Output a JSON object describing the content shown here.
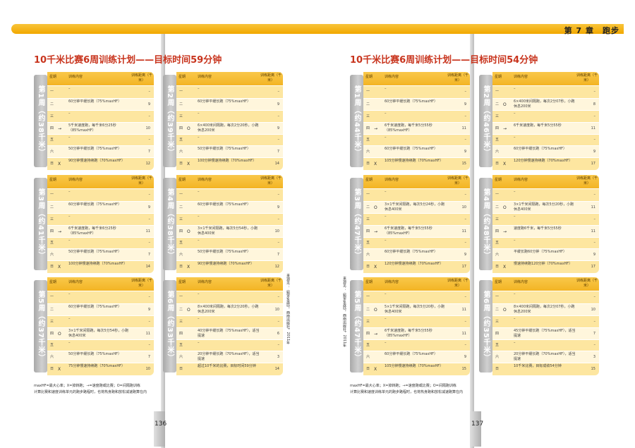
{
  "chapter": "第 7 章　跑步",
  "pages": [
    {
      "title": "10千米比赛6周训练计划——目标时间59分钟",
      "page_number": "136",
      "footnote_lines": [
        "maxHF=最大心率；X=掉转跑；→=速度跑或比赛；O=间隔跑训练",
        "计算比赛和速度训练单元的跑步路程时，也将热身跑和放松减速跑算在内"
      ],
      "source": "来源见：《跑步圣经》，西南出版社，2011年",
      "weeks": [
        {
          "label": "第1周（约38千米）",
          "rows": [
            {
              "day": "一",
              "mark": "",
              "content": "–",
              "dist": "–"
            },
            {
              "day": "二",
              "mark": "",
              "content": "60分钟平缓长跑（75%maxHF）",
              "dist": "9"
            },
            {
              "day": "三",
              "mark": "",
              "content": "–",
              "dist": "–"
            },
            {
              "day": "四",
              "mark": "→",
              "content": "5千米速度跑，每千米6分25秒（85%maxHF）",
              "dist": "10"
            },
            {
              "day": "五",
              "mark": "",
              "content": "–",
              "dist": "–"
            },
            {
              "day": "六",
              "mark": "",
              "content": "50分钟平缓长跑（75%maxHF）",
              "dist": "7"
            },
            {
              "day": "日",
              "mark": "X",
              "content": "90分钟慢速持续跑（70%maxHF）",
              "dist": "12"
            }
          ]
        },
        {
          "label": "第2周（约39千米）",
          "rows": [
            {
              "day": "一",
              "mark": "",
              "content": "–",
              "dist": "–"
            },
            {
              "day": "二",
              "mark": "",
              "content": "60分钟平缓长跑（75%maxHF）",
              "dist": "9"
            },
            {
              "day": "三",
              "mark": "",
              "content": "–",
              "dist": "–"
            },
            {
              "day": "四",
              "mark": "O",
              "content": "6×400米间隔跑，每次2分20秒，小跑休息200米",
              "dist": "9"
            },
            {
              "day": "五",
              "mark": "",
              "content": "–",
              "dist": "–"
            },
            {
              "day": "六",
              "mark": "",
              "content": "50分钟平缓长跑（75%maxHF）",
              "dist": "7"
            },
            {
              "day": "日",
              "mark": "X",
              "content": "100分钟慢速持续跑（70%maxHF）",
              "dist": "14"
            }
          ]
        },
        {
          "label": "第3周（约41千米）",
          "rows": [
            {
              "day": "一",
              "mark": "",
              "content": "–",
              "dist": "–"
            },
            {
              "day": "二",
              "mark": "",
              "content": "60分钟平缓长跑（75%maxHF）",
              "dist": "9"
            },
            {
              "day": "三",
              "mark": "",
              "content": "–",
              "dist": "–"
            },
            {
              "day": "四",
              "mark": "→",
              "content": "6千米速度跑，每千米6分25秒（85%maxHF）",
              "dist": "11"
            },
            {
              "day": "五",
              "mark": "",
              "content": "–",
              "dist": "–"
            },
            {
              "day": "六",
              "mark": "",
              "content": "50分钟平缓长跑（75%maxHF）",
              "dist": "7"
            },
            {
              "day": "日",
              "mark": "X",
              "content": "100分钟慢速持续跑（70%maxHF）",
              "dist": "14"
            }
          ]
        },
        {
          "label": "第4周（约38千米）",
          "rows": [
            {
              "day": "一",
              "mark": "",
              "content": "–",
              "dist": "–"
            },
            {
              "day": "二",
              "mark": "",
              "content": "60分钟平缓长跑（75%maxHF）",
              "dist": "9"
            },
            {
              "day": "三",
              "mark": "",
              "content": "–",
              "dist": "–"
            },
            {
              "day": "四",
              "mark": "O",
              "content": "3×1千米间隔跑，每次5分54秒，小跑休息400米",
              "dist": "10"
            },
            {
              "day": "五",
              "mark": "",
              "content": "–",
              "dist": "–"
            },
            {
              "day": "六",
              "mark": "",
              "content": "50分钟平缓长跑（75%maxHF）",
              "dist": "7"
            },
            {
              "day": "日",
              "mark": "X",
              "content": "90分钟慢速持续跑（70%maxHF）",
              "dist": "12"
            }
          ]
        },
        {
          "label": "第5周（约37千米）",
          "rows": [
            {
              "day": "一",
              "mark": "",
              "content": "–",
              "dist": "–"
            },
            {
              "day": "二",
              "mark": "",
              "content": "60分钟平缓长跑（75%maxHF）",
              "dist": "9"
            },
            {
              "day": "三",
              "mark": "",
              "content": "–",
              "dist": "–"
            },
            {
              "day": "四",
              "mark": "O",
              "content": "3×1千米间隔跑，每次5分54秒，小跑休息400米",
              "dist": "11"
            },
            {
              "day": "五",
              "mark": "",
              "content": "–",
              "dist": "–"
            },
            {
              "day": "六",
              "mark": "",
              "content": "50分钟平缓长跑（75%maxHF）",
              "dist": "7"
            },
            {
              "day": "日",
              "mark": "X",
              "content": "75分钟慢速持续跑（70%maxHF）",
              "dist": "10"
            }
          ]
        },
        {
          "label": "第6周（约33千米）",
          "rows": [
            {
              "day": "一",
              "mark": "",
              "content": "–",
              "dist": "–"
            },
            {
              "day": "二",
              "mark": "O",
              "content": "8×400米间隔跑，每次2分20秒，小跑休息200米",
              "dist": "10"
            },
            {
              "day": "三",
              "mark": "",
              "content": "–",
              "dist": "–"
            },
            {
              "day": "四",
              "mark": "",
              "content": "40分钟平缓长跑（75%maxHF），适当提速",
              "dist": "6"
            },
            {
              "day": "五",
              "mark": "",
              "content": "–",
              "dist": "–"
            },
            {
              "day": "六",
              "mark": "",
              "content": "20分钟平缓长跑（70%maxHF），适当提速",
              "dist": "3"
            },
            {
              "day": "日",
              "mark": "",
              "content": "超过10千米的比赛，目标时间59分钟",
              "dist": "14"
            }
          ]
        }
      ]
    },
    {
      "title": "10千米比赛6周训练计划——目标时间54分钟",
      "page_number": "137",
      "footnote_lines": [
        "maxHF=最大心率；X=掉转跑；→=速度跑或比赛；O=间隔跑训练",
        "计算比赛和速度训练单元的跑步路程时，也将热身跑和放松减速跑算在内"
      ],
      "source": "来源见：《跑步圣经》，西南出版社，2011年",
      "weeks": [
        {
          "label": "第1周（约44千米）",
          "rows": [
            {
              "day": "一",
              "mark": "",
              "content": "–",
              "dist": "–"
            },
            {
              "day": "二",
              "mark": "",
              "content": "60分钟平缓长跑（75%maxHF）",
              "dist": "9"
            },
            {
              "day": "三",
              "mark": "",
              "content": "–",
              "dist": "–"
            },
            {
              "day": "四",
              "mark": "→",
              "content": "6千米速度跑，每千米5分55秒（85%maxHF）",
              "dist": "11"
            },
            {
              "day": "五",
              "mark": "",
              "content": "–",
              "dist": "–"
            },
            {
              "day": "六",
              "mark": "",
              "content": "60分钟平缓长跑（75%maxHF）",
              "dist": "9"
            },
            {
              "day": "日",
              "mark": "X",
              "content": "105分钟慢速持续跑（70%maxHF）",
              "dist": "15"
            }
          ]
        },
        {
          "label": "第2周（约46千米）",
          "rows": [
            {
              "day": "一",
              "mark": "",
              "content": "–",
              "dist": "–"
            },
            {
              "day": "二",
              "mark": "O",
              "content": "6×400米间隔跑，每次2分07秒，小跑休息200米",
              "dist": "8"
            },
            {
              "day": "三",
              "mark": "",
              "content": "–",
              "dist": "–"
            },
            {
              "day": "四",
              "mark": "→",
              "content": "6千米速度跑，每千米5分55秒",
              "dist": "11"
            },
            {
              "day": "五",
              "mark": "",
              "content": "–",
              "dist": "–"
            },
            {
              "day": "六",
              "mark": "",
              "content": "60分钟平缓长跑（75%maxHF）",
              "dist": "9"
            },
            {
              "day": "日",
              "mark": "X",
              "content": "120分钟慢速持续跑（70%maxHF）",
              "dist": "17"
            }
          ]
        },
        {
          "label": "第3周（约47千米）",
          "rows": [
            {
              "day": "一",
              "mark": "",
              "content": "–",
              "dist": "–"
            },
            {
              "day": "二",
              "mark": "O",
              "content": "3×1千米间隔跑，每次5分24秒，小跑休息400米",
              "dist": "10"
            },
            {
              "day": "三",
              "mark": "",
              "content": "–",
              "dist": "–"
            },
            {
              "day": "四",
              "mark": "→",
              "content": "6千米速度跑，每千米5分55秒（85%maxHF）",
              "dist": "11"
            },
            {
              "day": "五",
              "mark": "",
              "content": "–",
              "dist": "–"
            },
            {
              "day": "六",
              "mark": "",
              "content": "60分钟平缓长跑（75%maxHF）",
              "dist": "9"
            },
            {
              "day": "日",
              "mark": "X",
              "content": "120分钟慢速持续跑（70%maxHF）",
              "dist": "17"
            }
          ]
        },
        {
          "label": "第4周（约48千米）",
          "rows": [
            {
              "day": "一",
              "mark": "",
              "content": "–",
              "dist": "–"
            },
            {
              "day": "二",
              "mark": "O",
              "content": "3×1千米间隔跑，每次5分20秒，小跑休息400米",
              "dist": "11"
            },
            {
              "day": "三",
              "mark": "",
              "content": "–",
              "dist": "–"
            },
            {
              "day": "四",
              "mark": "→",
              "content": "速度跑6千米，每千米5分55秒",
              "dist": "11"
            },
            {
              "day": "五",
              "mark": "",
              "content": "–",
              "dist": "–"
            },
            {
              "day": "六",
              "mark": "",
              "content": "平缓长跑60分钟（75%maxHF）",
              "dist": "9"
            },
            {
              "day": "日",
              "mark": "X",
              "content": "慢速持续跑120分钟（70%maxHF）",
              "dist": "17"
            }
          ]
        },
        {
          "label": "第5周（约47千米）",
          "rows": [
            {
              "day": "一",
              "mark": "",
              "content": "–",
              "dist": "–"
            },
            {
              "day": "二",
              "mark": "O",
              "content": "5×1千米间隔跑，每次5分20秒，小跑休息400米",
              "dist": "11"
            },
            {
              "day": "三",
              "mark": "",
              "content": "–",
              "dist": "–"
            },
            {
              "day": "四",
              "mark": "→",
              "content": "6千米速度跑，每千米5分55秒（85%maxHF）",
              "dist": "11"
            },
            {
              "day": "五",
              "mark": "",
              "content": "–",
              "dist": "–"
            },
            {
              "day": "六",
              "mark": "",
              "content": "60分钟平缓长跑（75%maxHF）",
              "dist": "9"
            },
            {
              "day": "日",
              "mark": "X",
              "content": "105分钟慢速持续跑（70%maxHF）",
              "dist": "15"
            }
          ]
        },
        {
          "label": "第6周（约35千米）",
          "rows": [
            {
              "day": "一",
              "mark": "",
              "content": "–",
              "dist": "–"
            },
            {
              "day": "二",
              "mark": "O",
              "content": "8×400米间隔跑，每次2分07秒，小跑休息200米",
              "dist": "10"
            },
            {
              "day": "三",
              "mark": "",
              "content": "–",
              "dist": "–"
            },
            {
              "day": "四",
              "mark": "",
              "content": "45分钟平缓长跑（75%maxHF），适当提速",
              "dist": "7"
            },
            {
              "day": "五",
              "mark": "",
              "content": "–",
              "dist": "–"
            },
            {
              "day": "六",
              "mark": "",
              "content": "20分钟平缓长跑（70%maxHF），适当提速",
              "dist": "3"
            },
            {
              "day": "日",
              "mark": "",
              "content": "10千米比赛，目标成绩54分钟",
              "dist": "15"
            }
          ]
        }
      ]
    }
  ],
  "table_headers": {
    "day": "星期",
    "content": "训练内容",
    "dist": "训练距离（千米）"
  }
}
